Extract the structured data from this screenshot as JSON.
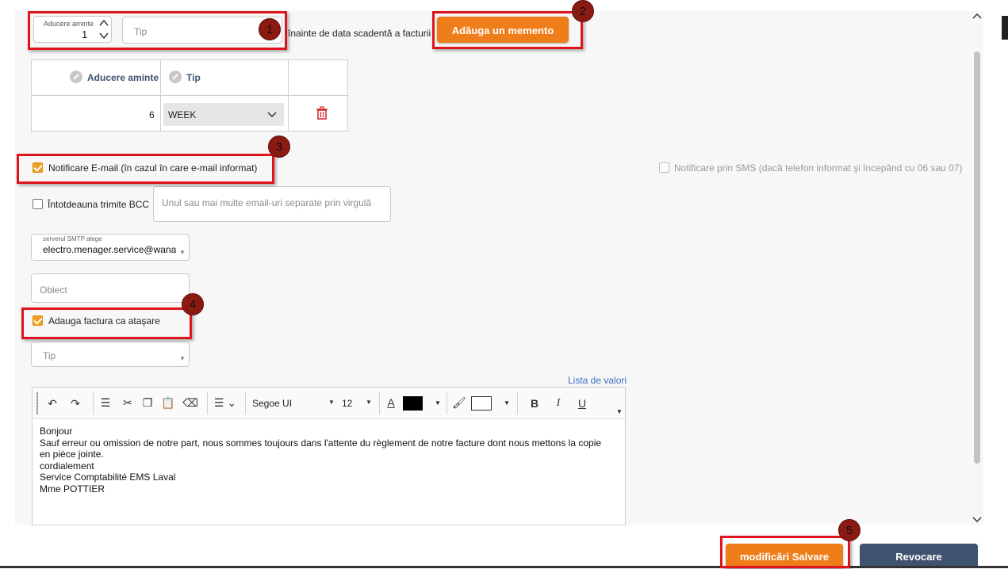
{
  "reminder": {
    "count_label": "Aducere aminte",
    "count_value": "1",
    "type_placeholder": "Tip",
    "suffix_text": "înainte de data scadentă a facturii",
    "add_button": "Adăuga un memento"
  },
  "table": {
    "columns": [
      "Aducere aminte",
      "Tip"
    ],
    "rows": [
      {
        "count": "6",
        "type": "WEEK"
      }
    ]
  },
  "email_notify": {
    "label": "Notificare E-mail (în cazul în care e-mail informat)",
    "checked": true
  },
  "sms_notify": {
    "label": "Notificare prin SMS (dacă telefon informat şi începând cu 06 sau 07)",
    "checked": false
  },
  "bcc": {
    "label": "Întotdeauna trimite BCC",
    "checked": false,
    "placeholder": "Unul sau mai multe email-uri separate prin virgulă"
  },
  "smtp": {
    "label": "serverul SMTP alege",
    "value": "electro.menager.service@wana"
  },
  "subject_placeholder": "Obiect",
  "attach_invoice": {
    "label": "Adauga factura ca ataşare",
    "checked": true
  },
  "attach_type_placeholder": "Tip",
  "values_link": "Lista de valori",
  "editor": {
    "font": "Segoe UI",
    "size": "12",
    "colors": {
      "text": "#000000",
      "highlight": "#ffffff"
    },
    "lines": [
      "Bonjour",
      "Sauf erreur ou omission de notre part, nous sommes toujours dans l'attente du règlement de notre facture dont nous mettons la copie",
      "en pièce jointe.",
      "cordialement",
      "Service Comptabilité EMS Laval",
      "Mme POTTIER"
    ]
  },
  "footer": {
    "save_button": "modificări Salvare",
    "cancel_button": "Revocare"
  },
  "badges": [
    "1",
    "2",
    "3",
    "4",
    "5"
  ],
  "accent_colors": {
    "orange": "#ee7d1a",
    "annotation_red": "#e0141c",
    "dark_button": "#3f5270"
  }
}
